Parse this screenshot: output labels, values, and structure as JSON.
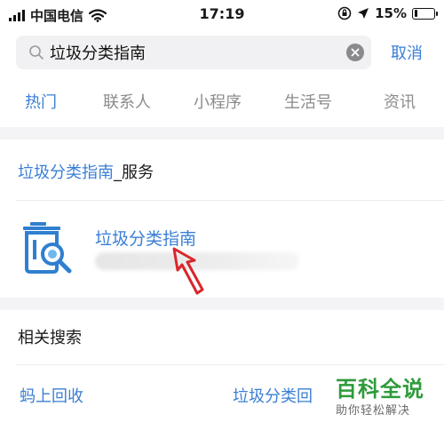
{
  "status_bar": {
    "carrier": "中国电信",
    "time": "17:19",
    "battery": "15%",
    "battery_level": 0.15,
    "icons": [
      "signal-icon",
      "wifi-icon",
      "orientation-lock-icon",
      "location-icon",
      "battery-icon"
    ]
  },
  "search": {
    "query": "垃圾分类指南",
    "cancel_label": "取消",
    "icons": [
      "search-icon",
      "clear-icon"
    ]
  },
  "tabs": [
    {
      "label": "热门",
      "active": true
    },
    {
      "label": "联系人",
      "active": false
    },
    {
      "label": "小程序",
      "active": false
    },
    {
      "label": "生活号",
      "active": false
    },
    {
      "label": "资讯",
      "active": false
    }
  ],
  "service_section": {
    "title_highlight": "垃圾分类指南",
    "title_suffix": "_服务",
    "result": {
      "title": "垃圾分类指南",
      "logo": "trash-search-logo"
    }
  },
  "related_section": {
    "title": "相关搜索",
    "items": [
      "蚂上回收",
      "垃圾分类回"
    ]
  },
  "watermark": {
    "title": "百科全说",
    "subtitle": "助你轻松解决"
  },
  "colors": {
    "accent": "#3a7fd5",
    "text": "#1a1a1a",
    "muted": "#8c8c8c",
    "band": "#f4f4f6",
    "watermark": "#2e9b3a",
    "pointer": "#d9262c"
  }
}
